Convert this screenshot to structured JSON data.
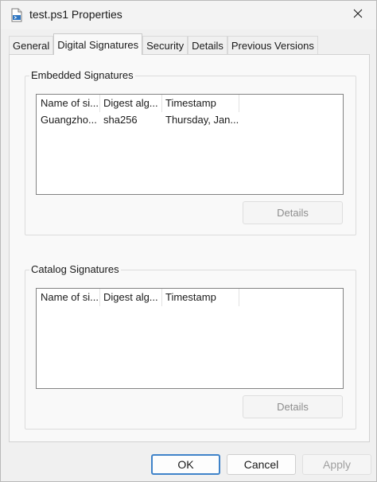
{
  "window": {
    "title": "test.ps1 Properties",
    "icon": "powershell-script-file-icon",
    "close_icon": "close-icon"
  },
  "tabs": [
    {
      "label": "General",
      "active": false
    },
    {
      "label": "Digital Signatures",
      "active": true
    },
    {
      "label": "Security",
      "active": false
    },
    {
      "label": "Details",
      "active": false
    },
    {
      "label": "Previous Versions",
      "active": false
    }
  ],
  "embedded": {
    "label": "Embedded Signatures",
    "columns": [
      "Name of si...",
      "Digest alg...",
      "Timestamp"
    ],
    "rows": [
      [
        "Guangzho...",
        "sha256",
        "Thursday, Jan..."
      ]
    ],
    "details_label": "Details",
    "details_enabled": false
  },
  "catalog": {
    "label": "Catalog Signatures",
    "columns": [
      "Name of si...",
      "Digest alg...",
      "Timestamp"
    ],
    "rows": [],
    "details_label": "Details",
    "details_enabled": false
  },
  "footer": {
    "ok_label": "OK",
    "cancel_label": "Cancel",
    "apply_label": "Apply",
    "apply_enabled": false
  },
  "colors": {
    "accent": "#3f83c9",
    "disabled_text": "#8d8d8d"
  }
}
